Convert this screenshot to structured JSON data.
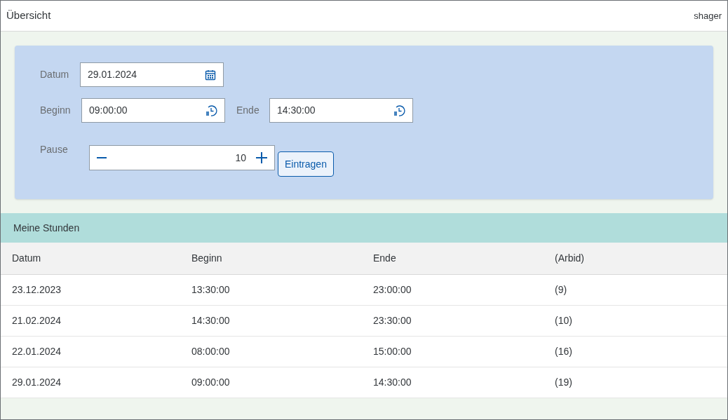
{
  "header": {
    "title": "Übersicht",
    "user": "shager"
  },
  "form": {
    "date": {
      "label": "Datum",
      "value": "29.01.2024"
    },
    "start": {
      "label": "Beginn",
      "value": "09:00:00"
    },
    "end": {
      "label": "Ende",
      "value": "14:30:00"
    },
    "pause": {
      "label": "Pause",
      "value": "10"
    },
    "submit": "Eintragen"
  },
  "table": {
    "title": "Meine Stunden",
    "columns": [
      "Datum",
      "Beginn",
      "Ende",
      "(Arbid)"
    ],
    "rows": [
      [
        "23.12.2023",
        "13:30:00",
        "23:00:00",
        "(9)"
      ],
      [
        "21.02.2024",
        "14:30:00",
        "23:30:00",
        "(10)"
      ],
      [
        "22.01.2024",
        "08:00:00",
        "15:00:00",
        "(16)"
      ],
      [
        "29.01.2024",
        "09:00:00",
        "14:30:00",
        "(19)"
      ]
    ]
  }
}
